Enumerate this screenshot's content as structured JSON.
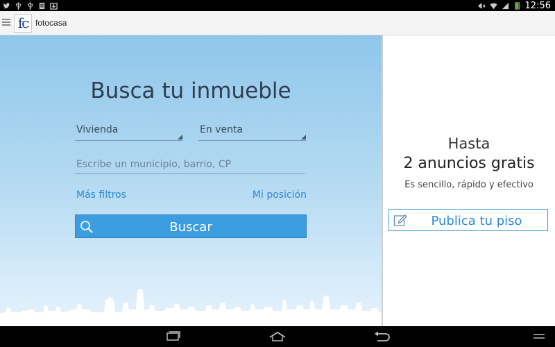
{
  "status_bar": {
    "time": "12:56",
    "left_icons": [
      "twitter-icon",
      "usb-icon",
      "usb-icon",
      "document-icon",
      "download-icon"
    ],
    "right_icons": [
      "mute-icon",
      "wifi-icon",
      "signal-icon",
      "battery-icon"
    ]
  },
  "action_bar": {
    "logo_text": "fc",
    "app_name": "fotocasa"
  },
  "search": {
    "heading": "Busca tu inmueble",
    "property_type": "Vivienda",
    "operation": "En venta",
    "location_placeholder": "Escribe un municipio, barrio, CP",
    "more_filters": "Más filtros",
    "my_position": "Mi posición",
    "search_button": "Buscar"
  },
  "promo": {
    "line1": "Hasta",
    "line2": "2 anuncios gratis",
    "subtitle": "Es sencillo, rápido y efectivo",
    "publish_button": "Publica tu piso"
  },
  "colors": {
    "accent": "#3b9ddf",
    "link": "#2a8ad8",
    "sky_top": "#8fc6ea",
    "sky_bottom": "#e6f3fc"
  },
  "nav_bar": {
    "buttons": [
      "recent-apps-icon",
      "home-icon",
      "back-icon",
      "menu-icon"
    ]
  }
}
